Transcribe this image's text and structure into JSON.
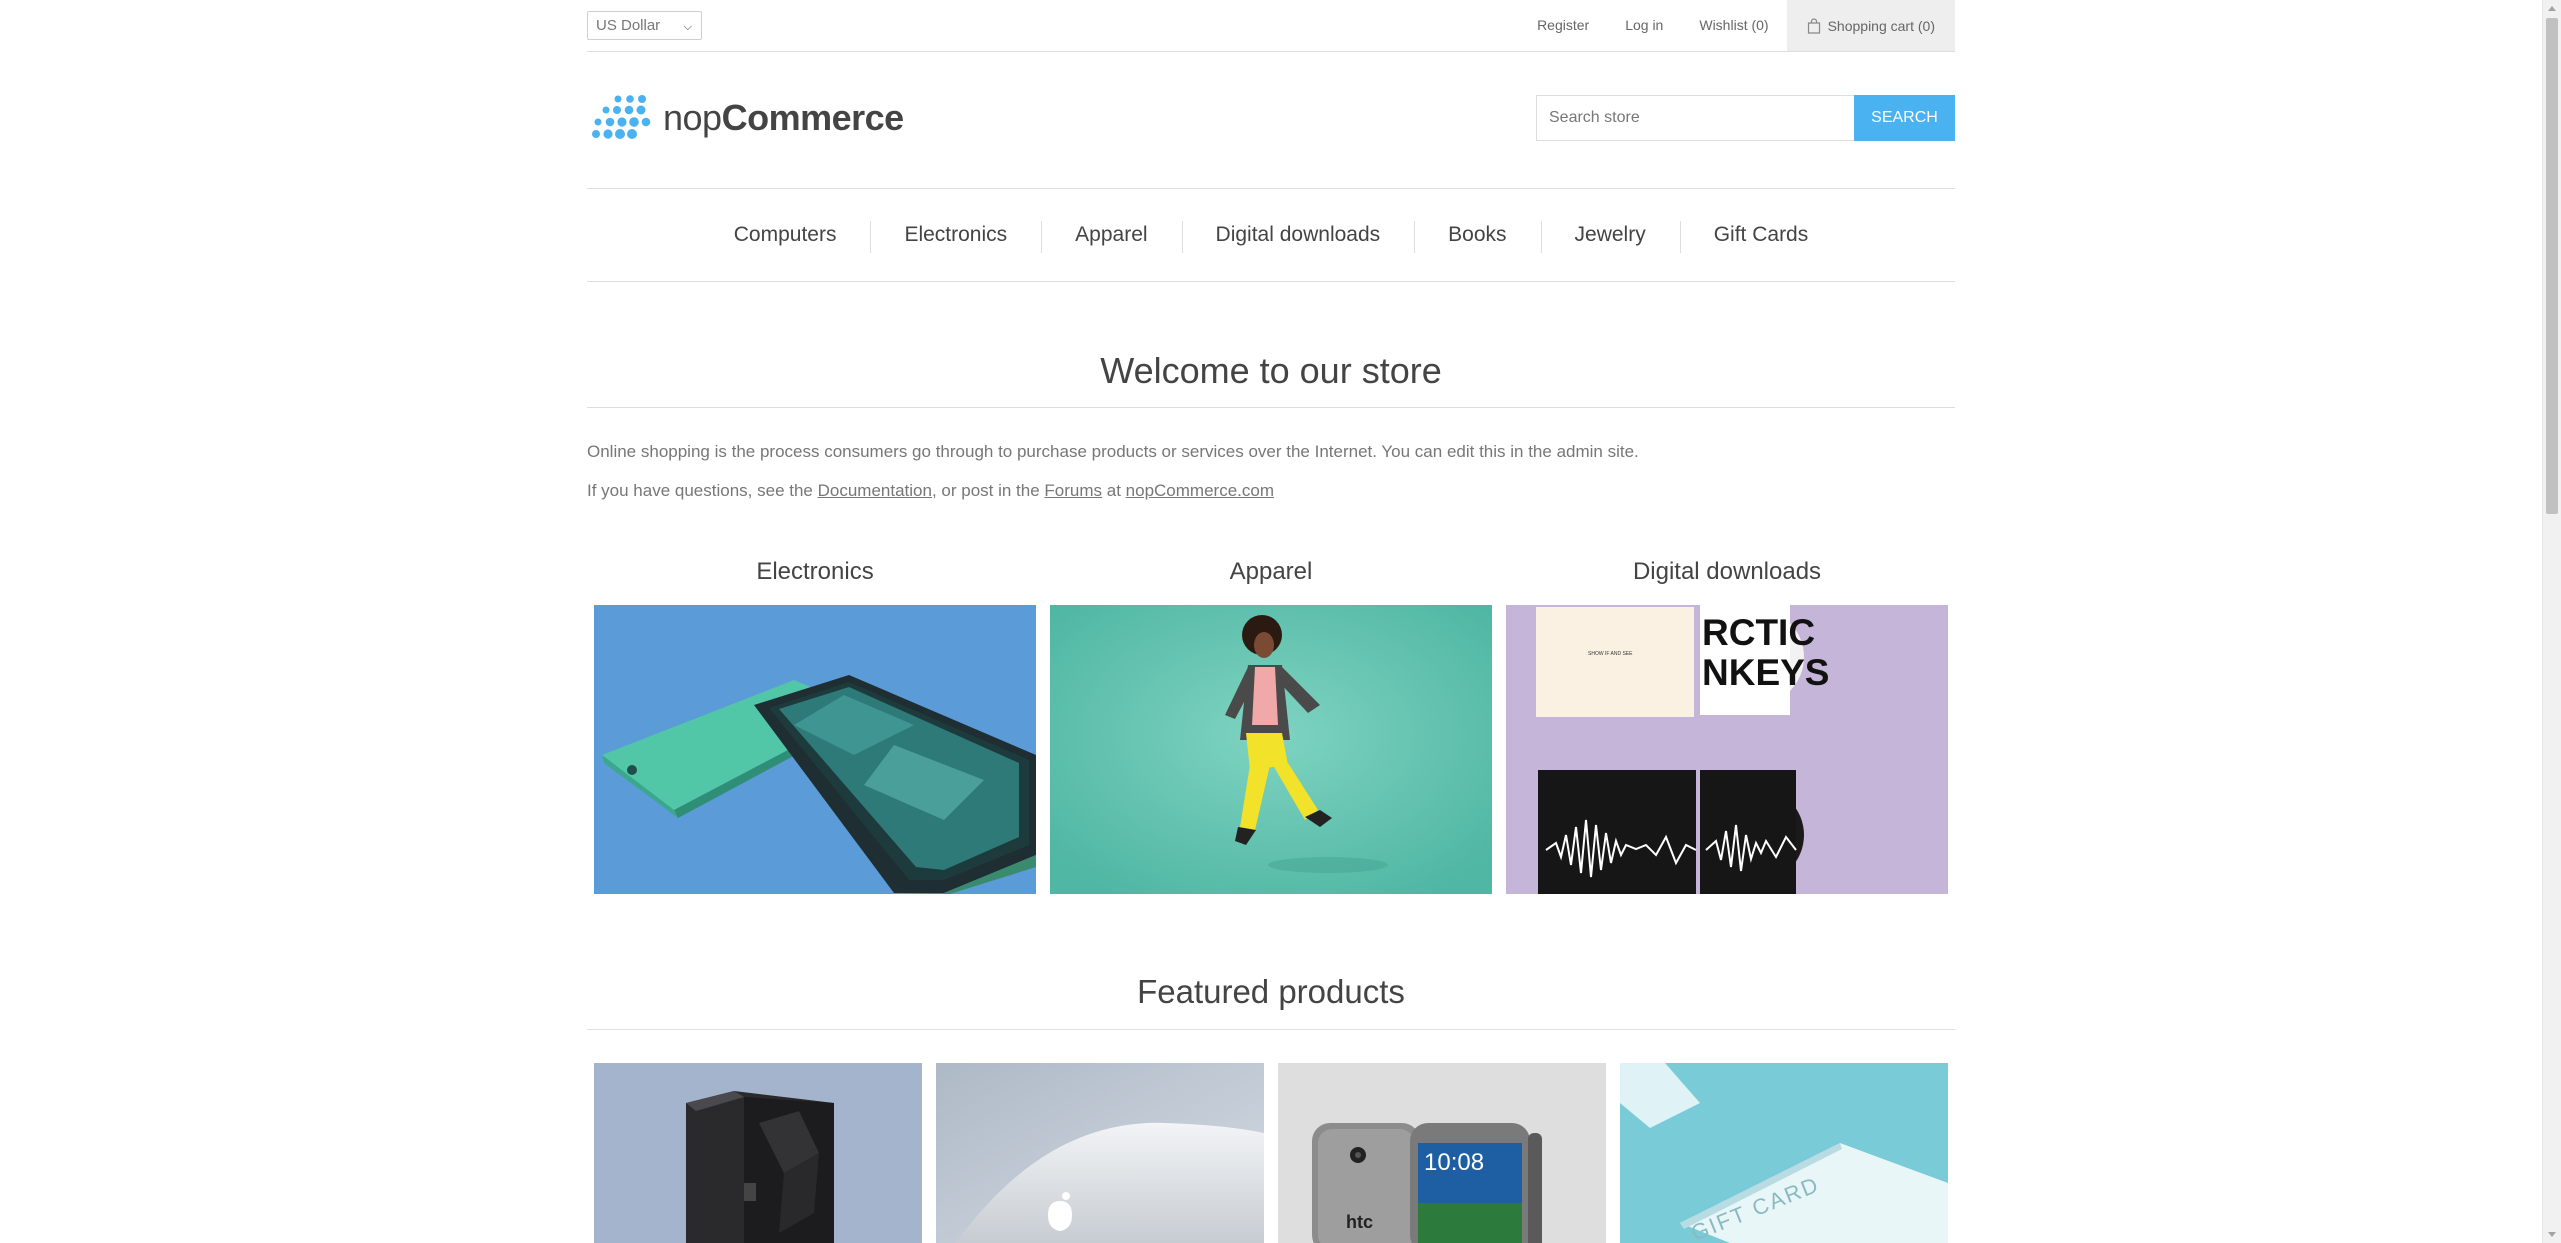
{
  "header": {
    "currency": "US Dollar",
    "links": {
      "register": "Register",
      "login": "Log in",
      "wishlist": "Wishlist (0)",
      "cart": "Shopping cart (0)"
    }
  },
  "logo": {
    "text_light": "nop",
    "text_bold": "Commerce",
    "color": "#4ab2f1"
  },
  "search": {
    "placeholder": "Search store",
    "button_label": "Search"
  },
  "menu": {
    "items": [
      "Computers",
      "Electronics",
      "Apparel",
      "Digital downloads",
      "Books",
      "Jewelry",
      "Gift Cards"
    ]
  },
  "welcome": {
    "title": "Welcome to our store",
    "line1": "Online shopping is the process consumers go through to purchase products or services over the Internet. You can edit this in the admin site.",
    "line2_prefix": "If you have questions, see the ",
    "doc_link": "Documentation",
    "line2_mid": ", or post in the ",
    "forums_link": "Forums",
    "line2_at": " at ",
    "site_link": "nopCommerce.com"
  },
  "categories": [
    {
      "title": "Electronics",
      "image": "phone-image"
    },
    {
      "title": "Apparel",
      "image": "woman-jumping-image"
    },
    {
      "title": "Digital downloads",
      "image": "album-covers-image"
    }
  ],
  "album": {
    "small_cover_text": "SHOW IF AND SEE",
    "band_text": "RCTIC\nNKEYS"
  },
  "featured": {
    "title": "Featured products",
    "products": [
      {
        "image": "computer-tower-image"
      },
      {
        "image": "macbook-image"
      },
      {
        "image": "htc-phone-image",
        "clock": "10:08",
        "brand": "htc"
      },
      {
        "image": "gift-card-image",
        "card_text": "GIFT CARD"
      }
    ]
  },
  "colors": {
    "accent": "#4ab2f1",
    "text": "#444444",
    "muted": "#777777",
    "border": "#dddddd"
  }
}
